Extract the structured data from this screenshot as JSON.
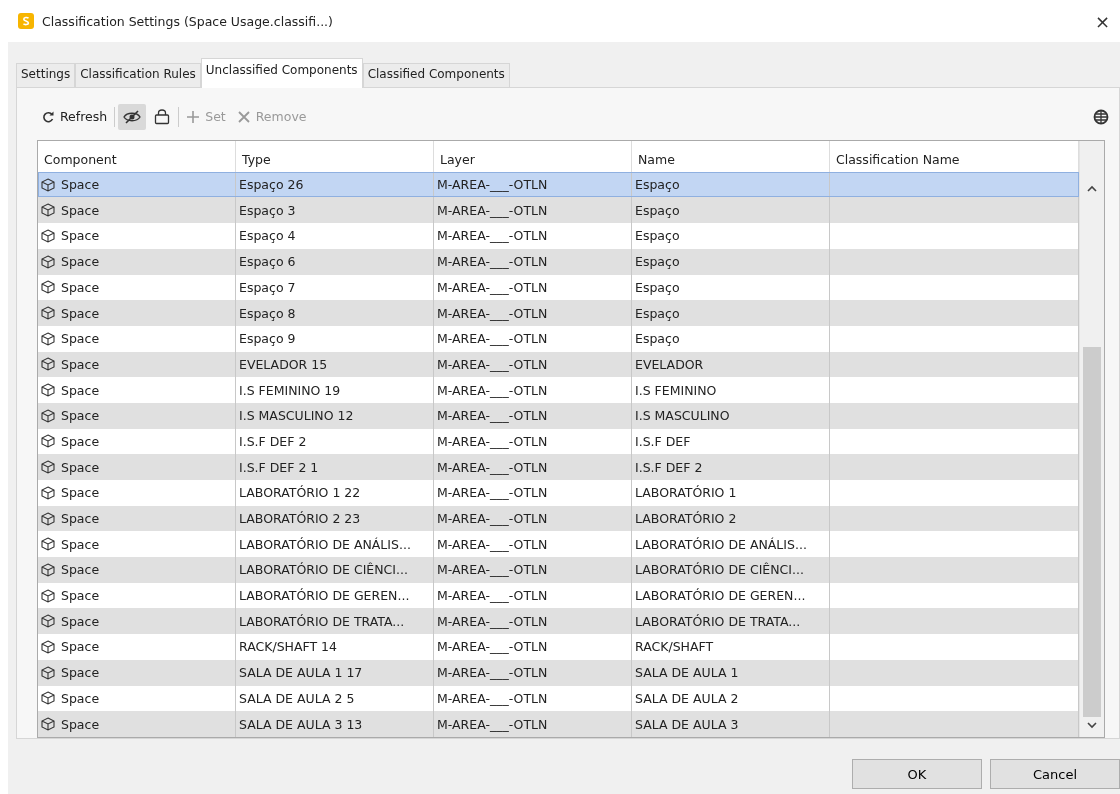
{
  "window": {
    "title": "Classification Settings (Space Usage.classifi...)",
    "close": "×"
  },
  "tabs": [
    {
      "label": "Settings",
      "selected": false
    },
    {
      "label": "Classification Rules",
      "selected": false
    },
    {
      "label": "Unclassified Components",
      "selected": true
    },
    {
      "label": "Classified Components",
      "selected": false
    }
  ],
  "toolbar": [
    {
      "kind": "refresh",
      "label": "Refresh",
      "disabled": false
    },
    {
      "kind": "separator"
    },
    {
      "kind": "hide",
      "pressed": true
    },
    {
      "kind": "isolate",
      "pressed": false
    },
    {
      "kind": "separator"
    },
    {
      "kind": "set",
      "label": "Set",
      "disabled": true
    },
    {
      "kind": "remove",
      "label": "Remove",
      "disabled": true
    }
  ],
  "table": {
    "columns": [
      "Component",
      "Type",
      "Layer",
      "Name",
      "Classification Name"
    ],
    "rows": [
      {
        "component": "Space",
        "type": "Espaço 26",
        "layer": "M-AREA-___-OTLN",
        "name": "Espaço",
        "selected": true
      },
      {
        "component": "Space",
        "type": "Espaço 3",
        "layer": "M-AREA-___-OTLN",
        "name": "Espaço",
        "selected": false
      },
      {
        "component": "Space",
        "type": "Espaço 4",
        "layer": "M-AREA-___-OTLN",
        "name": "Espaço",
        "selected": false
      },
      {
        "component": "Space",
        "type": "Espaço 6",
        "layer": "M-AREA-___-OTLN",
        "name": "Espaço",
        "selected": false
      },
      {
        "component": "Space",
        "type": "Espaço 7",
        "layer": "M-AREA-___-OTLN",
        "name": "Espaço",
        "selected": false
      },
      {
        "component": "Space",
        "type": "Espaço 8",
        "layer": "M-AREA-___-OTLN",
        "name": "Espaço",
        "selected": false
      },
      {
        "component": "Space",
        "type": "Espaço 9",
        "layer": "M-AREA-___-OTLN",
        "name": "Espaço",
        "selected": false
      },
      {
        "component": "Space",
        "type": "EVELADOR 15",
        "layer": "M-AREA-___-OTLN",
        "name": "EVELADOR",
        "selected": false
      },
      {
        "component": "Space",
        "type": "I.S FEMININO 19",
        "layer": "M-AREA-___-OTLN",
        "name": "I.S FEMININO",
        "selected": false
      },
      {
        "component": "Space",
        "type": "I.S MASCULINO 12",
        "layer": "M-AREA-___-OTLN",
        "name": "I.S MASCULINO",
        "selected": false
      },
      {
        "component": "Space",
        "type": "I.S.F DEF 2",
        "layer": "M-AREA-___-OTLN",
        "name": "I.S.F DEF",
        "selected": false
      },
      {
        "component": "Space",
        "type": "I.S.F DEF 2 1",
        "layer": "M-AREA-___-OTLN",
        "name": "I.S.F DEF 2",
        "selected": false
      },
      {
        "component": "Space",
        "type": "LABORATÓRIO 1 22",
        "layer": "M-AREA-___-OTLN",
        "name": "LABORATÓRIO 1",
        "selected": false
      },
      {
        "component": "Space",
        "type": "LABORATÓRIO 2 23",
        "layer": "M-AREA-___-OTLN",
        "name": "LABORATÓRIO 2",
        "selected": false
      },
      {
        "component": "Space",
        "type": "LABORATÓRIO DE ANÁLIS...",
        "layer": "M-AREA-___-OTLN",
        "name": "LABORATÓRIO DE ANÁLIS...",
        "selected": false
      },
      {
        "component": "Space",
        "type": "LABORATÓRIO DE CIÊNCI...",
        "layer": "M-AREA-___-OTLN",
        "name": "LABORATÓRIO DE CIÊNCI...",
        "selected": false
      },
      {
        "component": "Space",
        "type": "LABORATÓRIO DE GEREN...",
        "layer": "M-AREA-___-OTLN",
        "name": "LABORATÓRIO DE GEREN...",
        "selected": false
      },
      {
        "component": "Space",
        "type": "LABORATÓRIO DE TRATA...",
        "layer": "M-AREA-___-OTLN",
        "name": "LABORATÓRIO DE TRATA...",
        "selected": false
      },
      {
        "component": "Space",
        "type": "RACK/SHAFT 14",
        "layer": "M-AREA-___-OTLN",
        "name": "RACK/SHAFT",
        "selected": false
      },
      {
        "component": "Space",
        "type": "SALA DE AULA 1 17",
        "layer": "M-AREA-___-OTLN",
        "name": "SALA DE AULA 1",
        "selected": false
      },
      {
        "component": "Space",
        "type": "SALA DE AULA 2 5",
        "layer": "M-AREA-___-OTLN",
        "name": "SALA DE AULA 2",
        "selected": false
      },
      {
        "component": "Space",
        "type": "SALA DE AULA 3 13",
        "layer": "M-AREA-___-OTLN",
        "name": "SALA DE AULA 3",
        "selected": false
      }
    ]
  },
  "buttons": [
    "OK",
    "Cancel"
  ]
}
